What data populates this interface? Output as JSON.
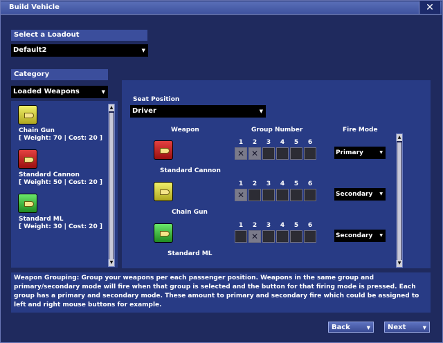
{
  "window": {
    "title": "Build Vehicle",
    "close_label": "✕"
  },
  "loadout": {
    "header": "Select a Loadout",
    "value": "Default2"
  },
  "category": {
    "header": "Category",
    "value": "Loaded Weapons",
    "items": [
      {
        "name": "Chain Gun",
        "stats": "[ Weight: 70 | Cost: 20 ]",
        "color": "yellow"
      },
      {
        "name": "Standard Cannon",
        "stats": "[ Weight: 50 | Cost: 20 ]",
        "color": "red"
      },
      {
        "name": "Standard ML",
        "stats": "[ Weight: 30 | Cost: 20 ]",
        "color": "green"
      }
    ]
  },
  "seat": {
    "header": "Seat Position",
    "value": "Driver"
  },
  "columns": {
    "weapon": "Weapon",
    "group": "Group Number",
    "fire": "Fire Mode"
  },
  "group_numbers": [
    "1",
    "2",
    "3",
    "4",
    "5",
    "6"
  ],
  "weapons": [
    {
      "name": "Standard Cannon",
      "color": "red",
      "checked": [
        true,
        true,
        false,
        false,
        false,
        false
      ],
      "fire_mode": "Primary"
    },
    {
      "name": "Chain Gun",
      "color": "yellow",
      "checked": [
        true,
        false,
        false,
        false,
        false,
        false
      ],
      "fire_mode": "Secondary"
    },
    {
      "name": "Standard ML",
      "color": "green",
      "checked": [
        false,
        true,
        false,
        false,
        false,
        false
      ],
      "fire_mode": "Secondary"
    }
  ],
  "info_text": "Weapon Grouping: Group your weapons per each passenger position.  Weapons in the same group and primary/secondary mode will fire when that group is selected and the button for that firing mode is pressed.  Each group has a primary and secondary mode.  These amount to primary and secondary fire which could be assigned to left and right mouse buttons for example.",
  "nav": {
    "back": "Back",
    "next": "Next"
  },
  "icons": {
    "dropdown": "chevron-down-icon",
    "close": "close-icon",
    "weapon": "bullet-icon",
    "check": "x-mark-icon"
  },
  "colors": {
    "background": "#1f2a5e",
    "header": "#3b4e9c",
    "panel": "#283b85"
  }
}
